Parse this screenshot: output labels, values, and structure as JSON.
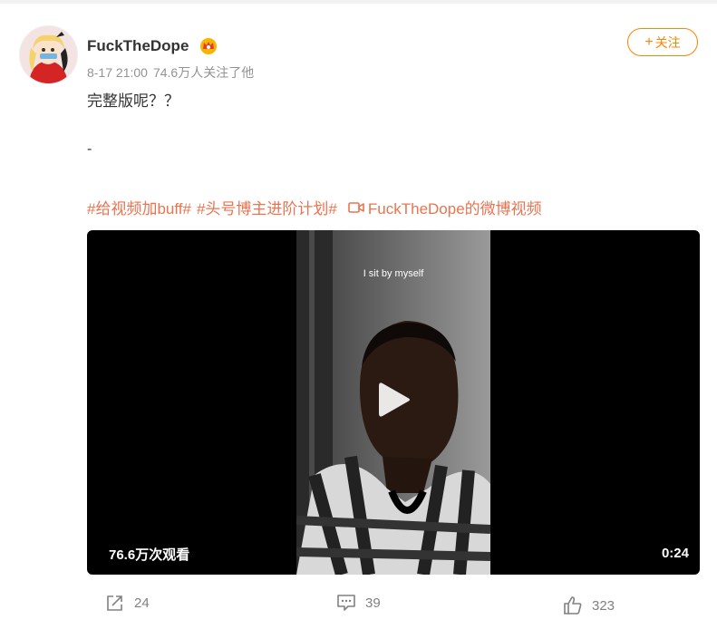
{
  "user": {
    "name": "FuckTheDope"
  },
  "meta": {
    "time": "8-17 21:00",
    "followers": "74.6万人关注了他"
  },
  "follow": {
    "plus": "+",
    "label": "关注"
  },
  "post": {
    "text": "完整版呢？？",
    "dash": "-"
  },
  "tags": [
    "#给视频加buff#",
    "#头号博主进阶计划#"
  ],
  "video_link": "FuckTheDope的微博视频",
  "video": {
    "caption": "I sit by myself",
    "views": "76.6万次观看",
    "duration": "0:24"
  },
  "actions": {
    "repost": "24",
    "comment": "39",
    "like": "323"
  },
  "colors": {
    "accent": "#ff8200",
    "topic": "#eb7350"
  }
}
